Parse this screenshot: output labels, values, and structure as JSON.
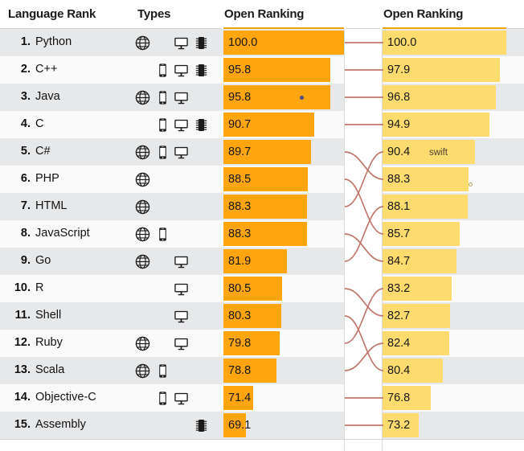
{
  "header": {
    "col_language": "Language Rank",
    "col_types": "Types",
    "col_open_left": "Open Ranking",
    "col_open_right": "Open Ranking",
    "accent_rule_color": "#f0a500"
  },
  "legend": {
    "icon_globe": "globe-icon",
    "icon_mobile": "mobile-icon",
    "icon_desktop": "desktop-icon",
    "icon_chip": "chip-icon"
  },
  "colors": {
    "bar_left": "#ffa50f",
    "bar_right": "#fddb6e",
    "row_odd": "#e7e8ea",
    "row_even": "#fafafa",
    "connector": "#c0776b",
    "marker_blue": "#4a4a8c"
  },
  "annotations": {
    "swift_label": "swift"
  },
  "chart_data": {
    "type": "bar",
    "title": "Language Rank",
    "xlabel": "",
    "ylabel": "",
    "ylim": [
      0,
      100
    ],
    "categories": [
      "Python",
      "C++",
      "Java",
      "C",
      "C#",
      "PHP",
      "HTML",
      "JavaScript",
      "Go",
      "R",
      "Shell",
      "Ruby",
      "Scala",
      "Objective-C",
      "Assembly"
    ],
    "series": [
      {
        "name": "Open Ranking",
        "values": [
          100.0,
          95.8,
          95.8,
          90.7,
          89.7,
          88.5,
          88.3,
          88.3,
          81.9,
          80.5,
          80.3,
          79.8,
          78.8,
          71.4,
          69.1
        ]
      },
      {
        "name": "Open Ranking",
        "values": [
          100.0,
          97.9,
          96.8,
          94.9,
          90.4,
          88.3,
          88.1,
          85.7,
          84.7,
          83.2,
          82.7,
          82.4,
          80.4,
          76.8,
          73.2
        ]
      }
    ],
    "legend_position": "none",
    "grid": false
  },
  "rows": [
    {
      "rank": "1.",
      "language": "Python",
      "types": [
        "globe",
        null,
        "desktop",
        "chip"
      ],
      "left_value": "100.0",
      "left_num": 100.0,
      "right_value": "100.0",
      "right_num": 100.0
    },
    {
      "rank": "2.",
      "language": "C++",
      "types": [
        null,
        "mobile",
        "desktop",
        "chip"
      ],
      "left_value": "95.8",
      "left_num": 95.8,
      "right_value": "97.9",
      "right_num": 97.9
    },
    {
      "rank": "3.",
      "language": "Java",
      "types": [
        "globe",
        "mobile",
        "desktop",
        null
      ],
      "left_value": "95.8",
      "left_num": 95.8,
      "right_value": "96.8",
      "right_num": 96.8
    },
    {
      "rank": "4.",
      "language": "C",
      "types": [
        null,
        "mobile",
        "desktop",
        "chip"
      ],
      "left_value": "90.7",
      "left_num": 90.7,
      "right_value": "94.9",
      "right_num": 94.9
    },
    {
      "rank": "5.",
      "language": "C#",
      "types": [
        "globe",
        "mobile",
        "desktop",
        null
      ],
      "left_value": "89.7",
      "left_num": 89.7,
      "right_value": "90.4",
      "right_num": 90.4
    },
    {
      "rank": "6.",
      "language": "PHP",
      "types": [
        "globe",
        null,
        null,
        null
      ],
      "left_value": "88.5",
      "left_num": 88.5,
      "right_value": "88.3",
      "right_num": 88.3
    },
    {
      "rank": "7.",
      "language": "HTML",
      "types": [
        "globe",
        null,
        null,
        null
      ],
      "left_value": "88.3",
      "left_num": 88.3,
      "right_value": "88.1",
      "right_num": 88.1
    },
    {
      "rank": "8.",
      "language": "JavaScript",
      "types": [
        "globe",
        "mobile",
        null,
        null
      ],
      "left_value": "88.3",
      "left_num": 88.3,
      "right_value": "85.7",
      "right_num": 85.7
    },
    {
      "rank": "9.",
      "language": "Go",
      "types": [
        "globe",
        null,
        "desktop",
        null
      ],
      "left_value": "81.9",
      "left_num": 81.9,
      "right_value": "84.7",
      "right_num": 84.7
    },
    {
      "rank": "10.",
      "language": "R",
      "types": [
        null,
        null,
        "desktop",
        null
      ],
      "left_value": "80.5",
      "left_num": 80.5,
      "right_value": "83.2",
      "right_num": 83.2
    },
    {
      "rank": "11.",
      "language": "Shell",
      "types": [
        null,
        null,
        "desktop",
        null
      ],
      "left_value": "80.3",
      "left_num": 80.3,
      "right_value": "82.7",
      "right_num": 82.7
    },
    {
      "rank": "12.",
      "language": "Ruby",
      "types": [
        "globe",
        null,
        "desktop",
        null
      ],
      "left_value": "79.8",
      "left_num": 79.8,
      "right_value": "82.4",
      "right_num": 82.4
    },
    {
      "rank": "13.",
      "language": "Scala",
      "types": [
        "globe",
        "mobile",
        null,
        null
      ],
      "left_value": "78.8",
      "left_num": 78.8,
      "right_value": "80.4",
      "right_num": 80.4
    },
    {
      "rank": "14.",
      "language": "Objective-C",
      "types": [
        null,
        "mobile",
        "desktop",
        null
      ],
      "left_value": "71.4",
      "left_num": 71.4,
      "right_value": "76.8",
      "right_num": 76.8
    },
    {
      "rank": "15.",
      "language": "Assembly",
      "types": [
        null,
        null,
        null,
        "chip"
      ],
      "left_value": "69.1",
      "left_num": 69.1,
      "right_value": "73.2",
      "right_num": 73.2
    }
  ],
  "connector_links": [
    {
      "from": 1,
      "to": 1
    },
    {
      "from": 2,
      "to": 2
    },
    {
      "from": 3,
      "to": 3
    },
    {
      "from": 4,
      "to": 4
    },
    {
      "from": 5,
      "to": 6
    },
    {
      "from": 6,
      "to": 8
    },
    {
      "from": 7,
      "to": 5
    },
    {
      "from": 8,
      "to": 9
    },
    {
      "from": 9,
      "to": 7
    },
    {
      "from": 10,
      "to": 11
    },
    {
      "from": 11,
      "to": 13
    },
    {
      "from": 12,
      "to": 10
    },
    {
      "from": 13,
      "to": 12
    },
    {
      "from": 14,
      "to": 14
    },
    {
      "from": 15,
      "to": 15
    }
  ]
}
